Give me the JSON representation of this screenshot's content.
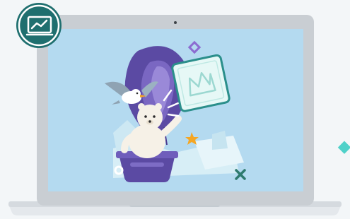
{
  "illustration": {
    "subject": "laptop-with-polar-bear-hot-air-balloon",
    "badge_icon": "chart-line-icon",
    "card_icon": "crown-icon",
    "colors": {
      "background": "#f3f6f8",
      "laptop_frame": "#c9ced3",
      "screen": "#b4daf0",
      "badge_fill": "#1f6f6f",
      "balloon_purple": "#5b4aa3",
      "balloon_light": "#7a67c2",
      "card_fill": "#e6f8f6",
      "card_border": "#2b8f8b",
      "accent_teal": "#4fd1c9",
      "accent_orange": "#f5a623",
      "accent_purple": "#8c6cd1",
      "accent_x": "#2e7a6e"
    }
  }
}
